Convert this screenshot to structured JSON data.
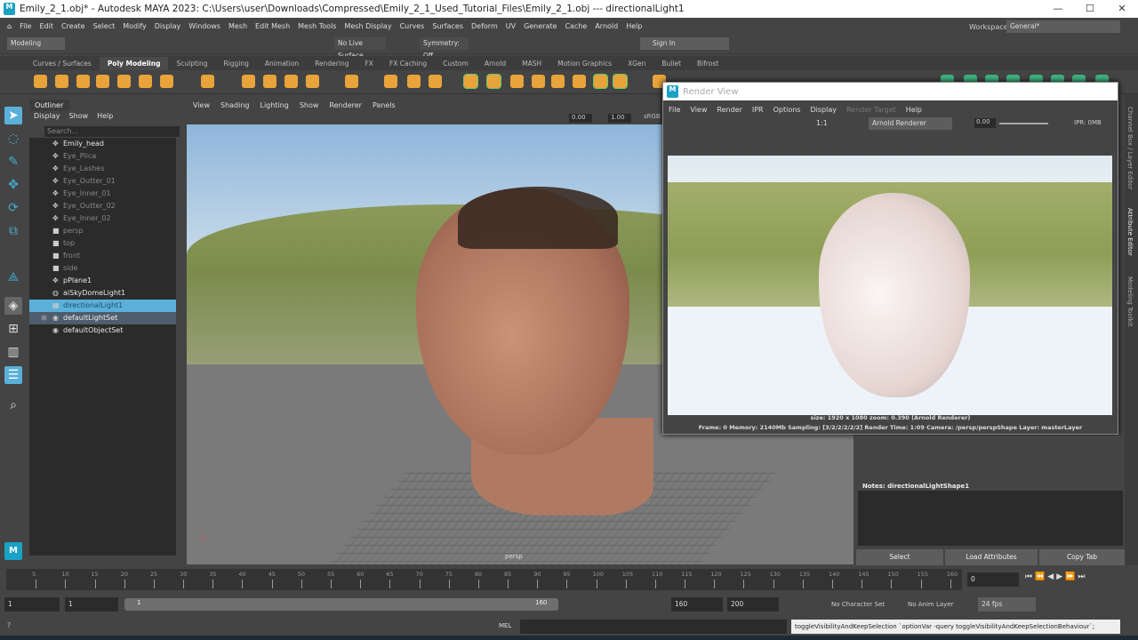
{
  "title": "Emily_2_1.obj* - Autodesk MAYA 2023: C:\\Users\\user\\Downloads\\Compressed\\Emily_2_1_Used_Tutorial_Files\\Emily_2_1.obj   ---   directionalLight1",
  "menu": [
    "File",
    "Edit",
    "Create",
    "Select",
    "Modify",
    "Display",
    "Windows",
    "Mesh",
    "Edit Mesh",
    "Mesh Tools",
    "Mesh Display",
    "Curves",
    "Surfaces",
    "Deform",
    "UV",
    "Generate",
    "Cache",
    "Arnold",
    "Help"
  ],
  "status": {
    "mode": "Modeling",
    "live_surface": "No Live Surface",
    "symmetry": "Symmetry: Off",
    "sign_in": "Sign In",
    "workspace_label": "Workspace:",
    "workspace": "General*"
  },
  "shelf_tabs": [
    "Curves / Surfaces",
    "Poly Modeling",
    "Sculpting",
    "Rigging",
    "Animation",
    "Rendering",
    "FX",
    "FX Caching",
    "Custom",
    "Arnold",
    "MASH",
    "Motion Graphics",
    "XGen",
    "Bullet",
    "Bifrost"
  ],
  "shelf_active": "Poly Modeling",
  "outliner": {
    "tab": "Outliner",
    "menu": [
      "Display",
      "Show",
      "Help"
    ],
    "search_placeholder": "Search...",
    "items": [
      {
        "label": "Emily_head",
        "icon": "transform-icon",
        "state": "bright"
      },
      {
        "label": "Eye_Plica",
        "icon": "transform-icon",
        "state": "dim"
      },
      {
        "label": "Eye_Lashes",
        "icon": "transform-icon",
        "state": "dim"
      },
      {
        "label": "Eye_Outter_01",
        "icon": "transform-icon",
        "state": "dim"
      },
      {
        "label": "Eye_Inner_01",
        "icon": "transform-icon",
        "state": "dim"
      },
      {
        "label": "Eye_Outter_02",
        "icon": "transform-icon",
        "state": "dim"
      },
      {
        "label": "Eye_Inner_02",
        "icon": "transform-icon",
        "state": "dim"
      },
      {
        "label": "persp",
        "icon": "camera-icon",
        "state": "dim"
      },
      {
        "label": "top",
        "icon": "camera-icon",
        "state": "dim"
      },
      {
        "label": "front",
        "icon": "camera-icon",
        "state": "dim"
      },
      {
        "label": "side",
        "icon": "camera-icon",
        "state": "dim"
      },
      {
        "label": "pPlane1",
        "icon": "transform-icon",
        "state": "bright"
      },
      {
        "label": "aiSkyDomeLight1",
        "icon": "skydome-icon",
        "state": "bright"
      },
      {
        "label": "directionalLight1",
        "icon": "directional-light-icon",
        "state": "selected"
      },
      {
        "label": "defaultLightSet",
        "icon": "set-icon",
        "state": "highlight"
      },
      {
        "label": "defaultObjectSet",
        "icon": "set-icon",
        "state": "bright"
      }
    ]
  },
  "viewport": {
    "menu": [
      "View",
      "Shading",
      "Lighting",
      "Show",
      "Renderer",
      "Panels"
    ],
    "exposure": "0.00",
    "gamma": "1.00",
    "colorspace": "sRGB",
    "camera": "persp"
  },
  "render_view": {
    "title": "Render View",
    "menu": [
      "File",
      "View",
      "Render",
      "IPR",
      "Options",
      "Display",
      "Render Target",
      "Help"
    ],
    "ratio": "1:1",
    "renderer": "Arnold Renderer",
    "exposure": "0.00",
    "ipr": "IPR: 0MB",
    "size_info": "size: 1920 x 1080 zoom: 0.390     (Arnold Renderer)",
    "stats": "Frame: 0    Memory: 2140Mb    Sampling: [3/2/2/2/2/2]    Render Time: 1:09    Camera: /persp/perspShape    Layer: masterLayer"
  },
  "attribute_editor": {
    "notes": "Notes:  directionalLightShape1",
    "buttons": [
      "Select",
      "Load Attributes",
      "Copy Tab"
    ]
  },
  "side_tabs": [
    "Channel Box / Layer Editor",
    "Attribute Editor",
    "Modeling Toolkit"
  ],
  "timeline": {
    "ticks": [
      "5",
      "10",
      "15",
      "20",
      "25",
      "30",
      "35",
      "40",
      "45",
      "50",
      "55",
      "60",
      "65",
      "70",
      "75",
      "80",
      "85",
      "90",
      "95",
      "100",
      "105",
      "110",
      "115",
      "120",
      "125",
      "130",
      "135",
      "140",
      "145",
      "150",
      "155",
      "160"
    ],
    "current_frame": "0"
  },
  "range": {
    "start": "1",
    "anim_start": "1",
    "slider_start": "1",
    "slider_end": "160",
    "end": "160",
    "anim_end": "200",
    "character_set": "No Character Set",
    "anim_layer": "No Anim Layer",
    "fps": "24 fps"
  },
  "command": {
    "lang": "MEL",
    "feedback": "toggleVisibilityAndKeepSelection `optionVar -query toggleVisibilityAndKeepSelectionBehaviour`;"
  }
}
